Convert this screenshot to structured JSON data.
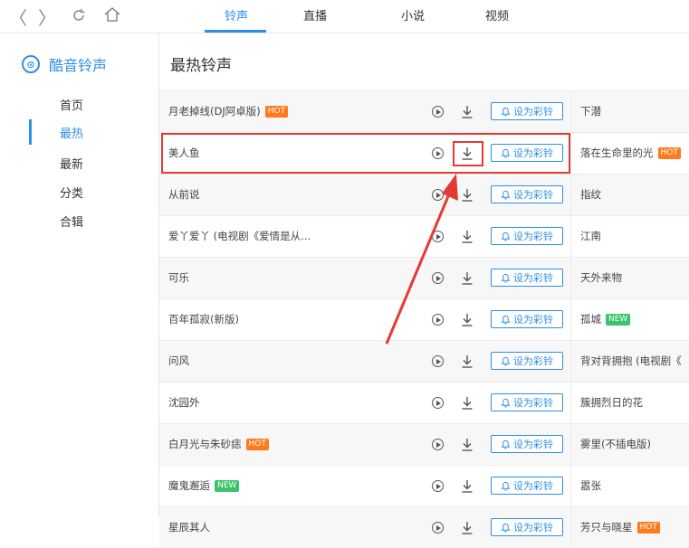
{
  "top_tabs": [
    "铃声",
    "直播",
    "小说",
    "视频"
  ],
  "nav": {
    "back": "〈",
    "forward": "〉"
  },
  "brand": {
    "name": "酷音铃声",
    "logo_glyph": "⊙"
  },
  "sidebar": {
    "items": [
      "首页",
      "最热",
      "最新",
      "分类",
      "合辑"
    ]
  },
  "main": {
    "title": "最热铃声"
  },
  "action_label": "设为彩铃",
  "rows": [
    {
      "left": "月老掉线(DJ阿卓版)",
      "left_badge": "HOT",
      "right": "下潜",
      "right_badge": ""
    },
    {
      "left": "美人鱼",
      "left_badge": "",
      "right": "落在生命里的光",
      "right_badge": "HOT"
    },
    {
      "left": "从前说",
      "left_badge": "",
      "right": "指纹",
      "right_badge": ""
    },
    {
      "left": "爱丫爱丫 (电视剧《爱情是从...",
      "left_badge": "",
      "right": "江南",
      "right_badge": ""
    },
    {
      "left": "可乐",
      "left_badge": "",
      "right": "天外来物",
      "right_badge": ""
    },
    {
      "left": "百年孤寂(新版)",
      "left_badge": "",
      "right": "孤城",
      "right_badge": "NEW"
    },
    {
      "left": "问风",
      "left_badge": "",
      "right": "背对背拥抱 (电视剧《",
      "right_badge": ""
    },
    {
      "left": "沈园外",
      "left_badge": "",
      "right": "簇拥烈日的花",
      "right_badge": ""
    },
    {
      "left": "白月光与朱砂痣",
      "left_badge": "HOT",
      "right": "雾里(不插电版)",
      "right_badge": ""
    },
    {
      "left": "魔鬼邂逅",
      "left_badge": "NEW",
      "right": "嚣张",
      "right_badge": ""
    },
    {
      "left": "星辰其人",
      "left_badge": "",
      "right": "芳只与晓星",
      "right_badge": "HOT"
    }
  ],
  "colors": {
    "accent": "#2f8fe6",
    "highlight": "#e53935",
    "hot": "#ff7a1a",
    "new": "#3cc36a"
  }
}
